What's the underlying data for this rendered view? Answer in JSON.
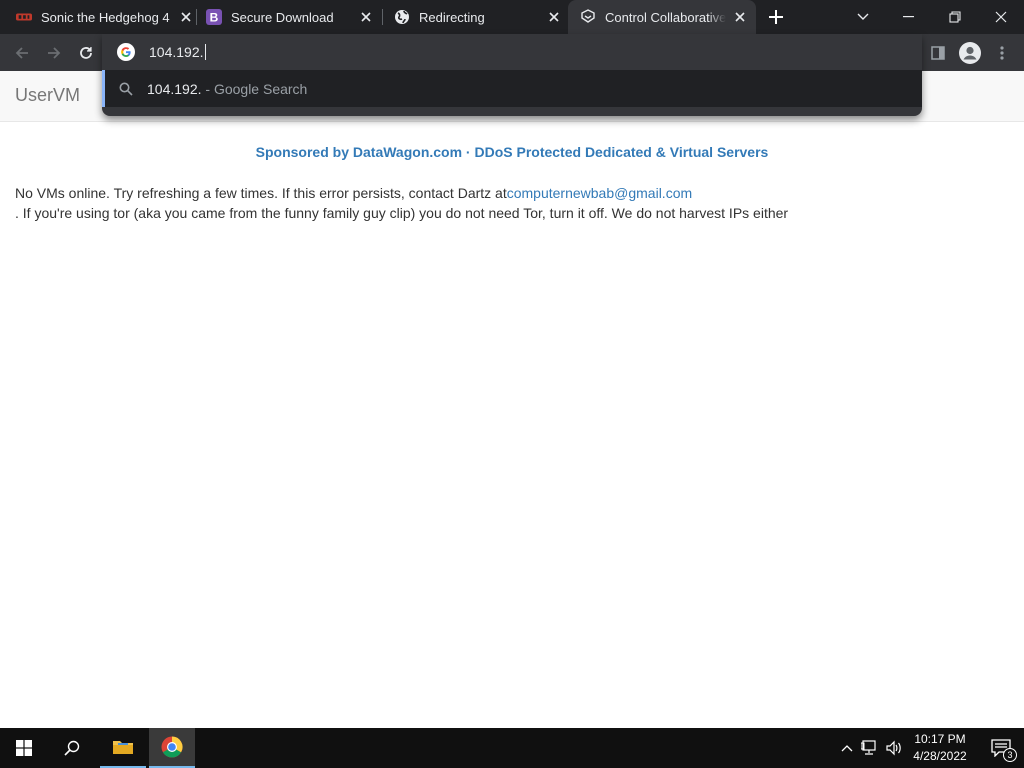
{
  "tabs": [
    {
      "title": "Sonic the Hedgehog 4",
      "favicon": "sonic-icon"
    },
    {
      "title": "Secure Download",
      "favicon": "bootstrap-icon"
    },
    {
      "title": "Redirecting",
      "favicon": "globe-icon"
    },
    {
      "title": "Control Collaborative V",
      "favicon": "uservm-icon",
      "active": true
    }
  ],
  "omnibox": {
    "input_value": "104.192.",
    "suggestion_query": "104.192.",
    "suggestion_suffix": " - Google Search"
  },
  "page": {
    "brand": "UserVM",
    "sponsor": "Sponsored by DataWagon.com · DDoS Protected Dedicated & Virtual Servers",
    "message_line1": "No VMs online. Try refreshing a few times. If this error persists, contact Dartz at",
    "email": "computernewbab@gmail.com",
    "message_line2": ". If you're using tor (aka you came from the funny family guy clip) you do not need Tor, turn it off. We do not harvest IPs either"
  },
  "taskbar": {
    "time": "10:17 PM",
    "date": "4/28/2022",
    "notification_count": "3"
  },
  "colors": {
    "tabstrip": "#202124",
    "toolbar": "#35363a",
    "link": "#337ab7",
    "taskbar": "#101010"
  }
}
